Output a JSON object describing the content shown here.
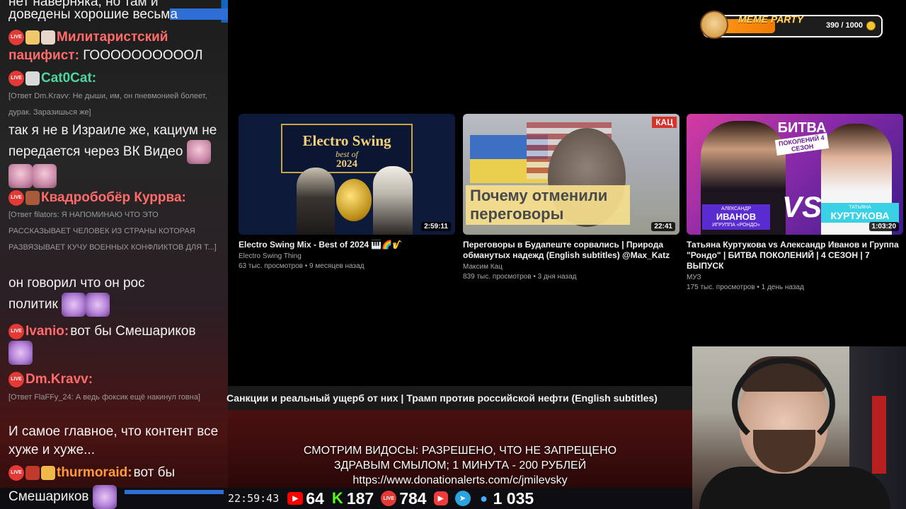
{
  "chat": {
    "messages": [
      {
        "type": "text",
        "text": "нет наверняка, но там и"
      },
      {
        "type": "text",
        "text": "доведены хорошие весьма"
      },
      {
        "type": "msg",
        "user": "Милитаристский",
        "user2": "пацифист:",
        "color": "#ff6b6b",
        "text": "ГООООООООООЛ"
      },
      {
        "type": "msg",
        "user": "Cat0Cat:",
        "color": "#4ed6a0",
        "text": ""
      },
      {
        "type": "reply",
        "text": "[Ответ Dm.Kravv: Не дыши, им, он пневмонией болеет, дурак. Заразишься же]"
      },
      {
        "type": "text",
        "text": "так я не в Израиле же, кациум не передается через ВК Видео"
      },
      {
        "type": "msg",
        "user": "Квадробобёр Куррва:",
        "color": "#ff6b6b",
        "text": ""
      },
      {
        "type": "reply",
        "text": "[Ответ filators: Я НАПОМИНАЮ ЧТО ЭТО РАССКАЗЫВАЕТ ЧЕЛОВЕК ИЗ СТРАНЫ КОТОРАЯ РАЗВЯЗЫВАЕТ КУЧУ ВОЕННЫХ КОНФЛИКТОВ ДЛЯ Т...]"
      },
      {
        "type": "text",
        "text": "он говорил что он рос политик"
      },
      {
        "type": "msg",
        "user": "Ivanio:",
        "color": "#ff6b6b",
        "text": "вот бы Смешариков"
      },
      {
        "type": "msg",
        "user": "Dm.Kravv:",
        "color": "#ff6b6b",
        "text": ""
      },
      {
        "type": "reply",
        "text": "[Ответ FlaFFy_24: А ведь фоксик ещё накинул говна]"
      },
      {
        "type": "text",
        "text": "И самое главное, что контент все хуже и хуже..."
      },
      {
        "type": "msg",
        "user": "thurmoraid:",
        "color": "#ff9a3c",
        "text": "вот бы"
      },
      {
        "type": "text",
        "text": "Смешариков"
      }
    ],
    "badge_label": "LIVE"
  },
  "videos": [
    {
      "title": "Electro Swing Mix - Best of 2024 🎹🌈🎷",
      "channel": "Electro Swing Thing",
      "meta": "63 тыс. просмотров • 9 месяцев назад",
      "duration": "2:59:11",
      "thumb": {
        "line1": "Electro Swing",
        "line2": "best of",
        "line3": "2024"
      }
    },
    {
      "title": "Переговоры в Будапеште сорвались | Природа обманутых надежд (English subtitles) @Max_Katz",
      "channel": "Максим Кац",
      "meta": "839 тыс. просмотров • 3 дня назад",
      "duration": "22:41",
      "thumb": {
        "badge": "КАЦ",
        "band": "Почему отменили переговоры"
      }
    },
    {
      "title": "Татьяна Куртукова vs Александр Иванов и Группа \"Рондо\" | БИТВА ПОКОЛЕНИЙ | 4 СЕЗОН | 7 ВЫПУСК",
      "channel": "МУЗ",
      "meta": "175 тыс. просмотров • 1 день назад",
      "duration": "1:03:20",
      "thumb": {
        "big": "БИТВА",
        "ribbon": "ПОКОЛЕНИЙ 4 СЕЗОН",
        "vs": "VS",
        "name1_top": "АЛЕКСАНДР",
        "name1": "ИВАНОВ",
        "name1_sub": "ИГРУППА «РОНДО»",
        "name2_top": "ТАТЬЯНА",
        "name2": "КУРТУКОВА"
      }
    }
  ],
  "meme_party": {
    "label": "MEME PARTY",
    "count": "390 / 1000",
    "progress": 0.39
  },
  "now_playing": "Санкции и реальный ущерб от них | Трамп против российской нефти (English subtitles)",
  "info": {
    "line1": "СМОТРИМ ВИДОСЫ: РАЗРЕШЕНО, ЧТО НЕ ЗАПРЕЩЕНО",
    "line2": "ЗДРАВЫМ СМЫЛОМ; 1 МИНУТА - 200 РУБЛЕЙ",
    "line3": "https://www.donationalerts.com/c/jmilevsky"
  },
  "stats": {
    "clock": "22:59:43",
    "youtube": "64",
    "kick": "187",
    "live": "784",
    "total": "1 035"
  }
}
